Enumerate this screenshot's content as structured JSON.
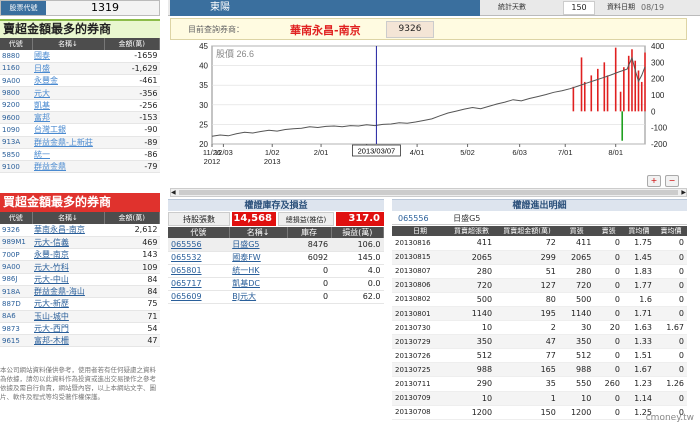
{
  "stock_code": {
    "label": "股票代號",
    "value": "1319"
  },
  "sell_section": {
    "title": "賣超金額最多的券商",
    "headers": [
      "代號",
      "名稱↓",
      "金額(萬)"
    ],
    "rows": [
      [
        "8880",
        "國泰",
        "-1659"
      ],
      [
        "1160",
        "日盛",
        "-1,629"
      ],
      [
        "9A00",
        "永豐金",
        "-461"
      ],
      [
        "9800",
        "元大",
        "-356"
      ],
      [
        "9200",
        "凱基",
        "-256"
      ],
      [
        "9600",
        "富邦",
        "-153"
      ],
      [
        "1090",
        "台灣工銀",
        "-90"
      ],
      [
        "913A",
        "群益金鼎-上新莊",
        "-89"
      ],
      [
        "5850",
        "統一",
        "-86"
      ],
      [
        "9100",
        "群益金鼎",
        "-79"
      ]
    ]
  },
  "buy_section": {
    "title": "買超金額最多的券商",
    "headers": [
      "代號",
      "名稱↓",
      "金額(萬)"
    ],
    "rows": [
      [
        "9326",
        "華南永昌-南京",
        "2,612"
      ],
      [
        "989M1",
        "元大-信義",
        "469"
      ],
      [
        "700P",
        "永豐-南京",
        "143"
      ],
      [
        "9A00",
        "元大-竹科",
        "109"
      ],
      [
        "986J",
        "元大-中山",
        "84"
      ],
      [
        "918A",
        "群益金鼎-海山",
        "84"
      ],
      [
        "887D",
        "元大-新歷",
        "75"
      ],
      [
        "8A6",
        "玉山-城中",
        "71"
      ],
      [
        "9873",
        "元大-西門",
        "54"
      ],
      [
        "9615",
        "富邦-木柵",
        "47"
      ]
    ]
  },
  "disclaimer": "本公司網站資料僅供參考，使用者若有任何疑慮之資料為依據，請勿以此資料作為投資或進出交易操作之參考依據及需自行負責，網站暨內容，以上本網站文字、圖片、軟件及程式等均受著作權保護。",
  "header": {
    "title": "東陽",
    "days_label": "統計天數",
    "days_value": "150",
    "date_label": "資料日期",
    "date_value": "08/19"
  },
  "query": {
    "label": "目前查詢券商：",
    "broker_name": "華南永昌-南京",
    "broker_code": "9326"
  },
  "chart_data": {
    "type": "line",
    "title": "",
    "price_label": "股價",
    "price_value": "26.6",
    "left_axis": {
      "ticks": [
        20,
        25,
        30,
        35,
        40,
        45
      ],
      "range": [
        20,
        45
      ]
    },
    "right_axis": {
      "ticks": [
        -200,
        -100,
        0,
        100,
        200,
        300,
        400
      ],
      "range": [
        -200,
        400
      ]
    },
    "x_ticks": [
      {
        "label": "11/26",
        "sub": "2012",
        "day": 0
      },
      {
        "label": "12/03",
        "sub": "",
        "day": 7
      },
      {
        "label": "1/02",
        "sub": "2013",
        "day": 37
      },
      {
        "label": "2/01",
        "sub": "",
        "day": 67
      },
      {
        "label": "3/01",
        "sub": "",
        "day": 95
      },
      {
        "label": "4/01",
        "sub": "",
        "day": 126
      },
      {
        "label": "5/02",
        "sub": "",
        "day": 157
      },
      {
        "label": "6/03",
        "sub": "",
        "day": 189
      },
      {
        "label": "7/01",
        "sub": "",
        "day": 217
      },
      {
        "label": "8/01",
        "sub": "",
        "day": 248
      }
    ],
    "cursor_label": "2013/03/07",
    "cursor_day": 101,
    "day_span": 266,
    "price_series": [
      [
        0,
        22.0
      ],
      [
        5,
        22.3
      ],
      [
        10,
        22.1
      ],
      [
        15,
        22.6
      ],
      [
        20,
        23.0
      ],
      [
        25,
        22.8
      ],
      [
        30,
        23.2
      ],
      [
        35,
        23.5
      ],
      [
        40,
        23.3
      ],
      [
        45,
        23.7
      ],
      [
        50,
        23.9
      ],
      [
        55,
        24.0
      ],
      [
        60,
        24.4
      ],
      [
        65,
        24.2
      ],
      [
        70,
        24.5
      ],
      [
        75,
        24.6
      ],
      [
        80,
        24.4
      ],
      [
        85,
        24.7
      ],
      [
        90,
        24.6
      ],
      [
        95,
        24.9
      ],
      [
        100,
        24.7
      ],
      [
        105,
        25.0
      ],
      [
        110,
        25.1
      ],
      [
        115,
        25.4
      ],
      [
        120,
        25.3
      ],
      [
        125,
        25.6
      ],
      [
        130,
        26.0
      ],
      [
        135,
        26.4
      ],
      [
        140,
        27.2
      ],
      [
        145,
        27.9
      ],
      [
        150,
        28.4
      ],
      [
        155,
        28.9
      ],
      [
        160,
        29.3
      ],
      [
        165,
        29.0
      ],
      [
        170,
        29.6
      ],
      [
        175,
        30.2
      ],
      [
        180,
        30.7
      ],
      [
        185,
        31.3
      ],
      [
        190,
        31.0
      ],
      [
        195,
        31.6
      ],
      [
        200,
        32.1
      ],
      [
        205,
        32.6
      ],
      [
        210,
        33.2
      ],
      [
        215,
        33.6
      ],
      [
        220,
        34.1
      ],
      [
        225,
        34.8
      ],
      [
        230,
        35.5
      ],
      [
        235,
        36.2
      ],
      [
        240,
        36.9
      ],
      [
        245,
        37.6
      ],
      [
        250,
        38.4
      ],
      [
        255,
        39.1
      ],
      [
        258,
        42.0
      ],
      [
        260,
        38.8
      ],
      [
        262,
        36.0
      ],
      [
        264,
        37.5
      ],
      [
        266,
        39.7
      ]
    ],
    "volume_bars": [
      [
        222,
        150
      ],
      [
        227,
        330
      ],
      [
        229,
        180
      ],
      [
        233,
        220
      ],
      [
        237,
        260
      ],
      [
        241,
        300
      ],
      [
        243,
        220
      ],
      [
        248,
        390
      ],
      [
        251,
        120
      ],
      [
        253,
        270
      ],
      [
        256,
        340
      ],
      [
        258,
        380
      ],
      [
        260,
        310
      ],
      [
        262,
        250
      ],
      [
        264,
        180
      ],
      [
        266,
        360
      ]
    ],
    "negative_bars": [
      [
        252,
        -180
      ]
    ]
  },
  "inventory": {
    "title": "權證庫存及損益",
    "holdings_label": "持股張數",
    "holdings_value": "14,568",
    "pl_label": "總損益(推估)",
    "pl_value": "317.0",
    "headers": [
      "代號",
      "名稱↓",
      "庫存",
      "損益(萬)"
    ],
    "rows": [
      [
        "065556",
        "日盛G5",
        "8476",
        "106.0"
      ],
      [
        "065532",
        "國泰FW",
        "6092",
        "145.0"
      ],
      [
        "065801",
        "統一HK",
        "0",
        "4.0"
      ],
      [
        "065717",
        "凱基DC",
        "0",
        "0.0"
      ],
      [
        "065609",
        "BJ元大",
        "0",
        "62.0"
      ]
    ]
  },
  "detail": {
    "title": "權證進出明細",
    "sub_code": "065556",
    "sub_name": "日盛G5",
    "headers": [
      "日期",
      "買賣超張數",
      "買賣超金額(萬)",
      "買張",
      "賣張",
      "買均價",
      "賣均價"
    ],
    "rows": [
      [
        "20130816",
        "411",
        "72",
        "411",
        "0",
        "1.75",
        "0"
      ],
      [
        "20130815",
        "2065",
        "299",
        "2065",
        "0",
        "1.45",
        "0"
      ],
      [
        "20130807",
        "280",
        "51",
        "280",
        "0",
        "1.83",
        "0"
      ],
      [
        "20130806",
        "720",
        "127",
        "720",
        "0",
        "1.77",
        "0"
      ],
      [
        "20130802",
        "500",
        "80",
        "500",
        "0",
        "1.6",
        "0"
      ],
      [
        "20130801",
        "1140",
        "195",
        "1140",
        "0",
        "1.71",
        "0"
      ],
      [
        "20130730",
        "10",
        "2",
        "30",
        "20",
        "1.63",
        "1.67"
      ],
      [
        "20130729",
        "350",
        "47",
        "350",
        "0",
        "1.33",
        "0"
      ],
      [
        "20130726",
        "512",
        "77",
        "512",
        "0",
        "1.51",
        "0"
      ],
      [
        "20130725",
        "988",
        "165",
        "988",
        "0",
        "1.67",
        "0"
      ],
      [
        "20130711",
        "290",
        "35",
        "550",
        "260",
        "1.23",
        "1.26"
      ],
      [
        "20130709",
        "10",
        "1",
        "10",
        "0",
        "1.14",
        "0"
      ],
      [
        "20130708",
        "1200",
        "150",
        "1200",
        "0",
        "1.25",
        "0"
      ]
    ]
  },
  "brand": "cmoney.tw"
}
